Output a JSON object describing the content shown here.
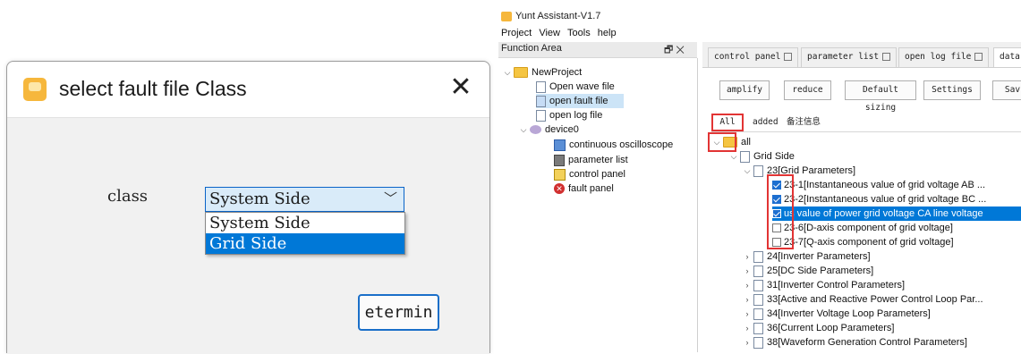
{
  "dialog": {
    "title": "select fault file Class",
    "close_glyph": "✕",
    "class_label": "class",
    "combo_value": "System Side",
    "options": [
      "System Side",
      "Grid Side"
    ],
    "selected_option": "Grid Side",
    "confirm_label": "etermin"
  },
  "app": {
    "title": "Yunt Assistant-V1.7",
    "menu": [
      "Project",
      "View",
      "Tools",
      "help"
    ],
    "function_area": {
      "title": "Function Area",
      "buttons": "🗗 ✕",
      "tree": {
        "project": "NewProject",
        "items": [
          "Open wave file",
          "open fault file",
          "open log file"
        ],
        "device": "device0",
        "device_items": [
          "continuous oscilloscope",
          "parameter list",
          "control panel",
          "fault panel"
        ]
      }
    },
    "tabs": [
      "control panel",
      "parameter list",
      "open log file",
      "data"
    ],
    "toolbar": [
      "amplify",
      "reduce",
      "Default sizing",
      "Settings",
      "Sav"
    ],
    "subtabs": [
      "All",
      "added",
      "备注信息"
    ],
    "data_tree": {
      "root": "all",
      "grid_side": "Grid Side",
      "group": "23[Grid Parameters]",
      "params": [
        "23-1[Instantaneous value of grid voltage AB ...",
        "23-2[Instantaneous value of grid voltage BC ...",
        "us value of power grid voltage CA line voltage",
        "23-6[D-axis component of grid voltage]",
        "23-7[Q-axis component of grid voltage]"
      ],
      "groups": [
        "24[Inverter Parameters]",
        "25[DC Side Parameters]",
        "31[Inverter Control Parameters]",
        "33[Active and Reactive Power Control Loop Par...",
        "34[Inverter Voltage Loop Parameters]",
        "36[Current Loop Parameters]",
        "38[Waveform Generation Control Parameters]"
      ]
    }
  },
  "colors": {
    "accent": "#0078d7",
    "highlight": "#e23434",
    "selection": "#cce4f7"
  }
}
